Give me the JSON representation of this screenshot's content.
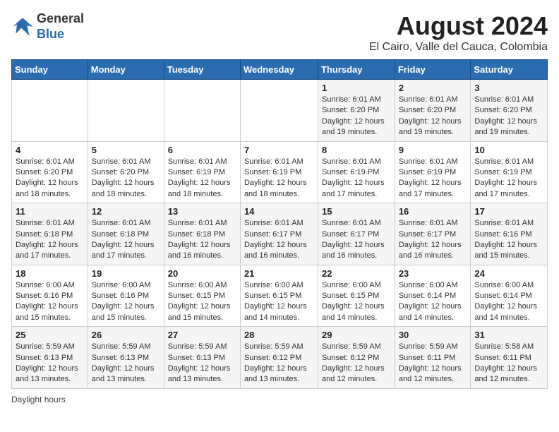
{
  "header": {
    "logo_general": "General",
    "logo_blue": "Blue",
    "title": "August 2024",
    "subtitle": "El Cairo, Valle del Cauca, Colombia"
  },
  "days_of_week": [
    "Sunday",
    "Monday",
    "Tuesday",
    "Wednesday",
    "Thursday",
    "Friday",
    "Saturday"
  ],
  "weeks": [
    [
      {
        "day": "",
        "info": ""
      },
      {
        "day": "",
        "info": ""
      },
      {
        "day": "",
        "info": ""
      },
      {
        "day": "",
        "info": ""
      },
      {
        "day": "1",
        "info": "Sunrise: 6:01 AM\nSunset: 6:20 PM\nDaylight: 12 hours\nand 19 minutes."
      },
      {
        "day": "2",
        "info": "Sunrise: 6:01 AM\nSunset: 6:20 PM\nDaylight: 12 hours\nand 19 minutes."
      },
      {
        "day": "3",
        "info": "Sunrise: 6:01 AM\nSunset: 6:20 PM\nDaylight: 12 hours\nand 19 minutes."
      }
    ],
    [
      {
        "day": "4",
        "info": "Sunrise: 6:01 AM\nSunset: 6:20 PM\nDaylight: 12 hours\nand 18 minutes."
      },
      {
        "day": "5",
        "info": "Sunrise: 6:01 AM\nSunset: 6:20 PM\nDaylight: 12 hours\nand 18 minutes."
      },
      {
        "day": "6",
        "info": "Sunrise: 6:01 AM\nSunset: 6:19 PM\nDaylight: 12 hours\nand 18 minutes."
      },
      {
        "day": "7",
        "info": "Sunrise: 6:01 AM\nSunset: 6:19 PM\nDaylight: 12 hours\nand 18 minutes."
      },
      {
        "day": "8",
        "info": "Sunrise: 6:01 AM\nSunset: 6:19 PM\nDaylight: 12 hours\nand 17 minutes."
      },
      {
        "day": "9",
        "info": "Sunrise: 6:01 AM\nSunset: 6:19 PM\nDaylight: 12 hours\nand 17 minutes."
      },
      {
        "day": "10",
        "info": "Sunrise: 6:01 AM\nSunset: 6:19 PM\nDaylight: 12 hours\nand 17 minutes."
      }
    ],
    [
      {
        "day": "11",
        "info": "Sunrise: 6:01 AM\nSunset: 6:18 PM\nDaylight: 12 hours\nand 17 minutes."
      },
      {
        "day": "12",
        "info": "Sunrise: 6:01 AM\nSunset: 6:18 PM\nDaylight: 12 hours\nand 17 minutes."
      },
      {
        "day": "13",
        "info": "Sunrise: 6:01 AM\nSunset: 6:18 PM\nDaylight: 12 hours\nand 16 minutes."
      },
      {
        "day": "14",
        "info": "Sunrise: 6:01 AM\nSunset: 6:17 PM\nDaylight: 12 hours\nand 16 minutes."
      },
      {
        "day": "15",
        "info": "Sunrise: 6:01 AM\nSunset: 6:17 PM\nDaylight: 12 hours\nand 16 minutes."
      },
      {
        "day": "16",
        "info": "Sunrise: 6:01 AM\nSunset: 6:17 PM\nDaylight: 12 hours\nand 16 minutes."
      },
      {
        "day": "17",
        "info": "Sunrise: 6:01 AM\nSunset: 6:16 PM\nDaylight: 12 hours\nand 15 minutes."
      }
    ],
    [
      {
        "day": "18",
        "info": "Sunrise: 6:00 AM\nSunset: 6:16 PM\nDaylight: 12 hours\nand 15 minutes."
      },
      {
        "day": "19",
        "info": "Sunrise: 6:00 AM\nSunset: 6:16 PM\nDaylight: 12 hours\nand 15 minutes."
      },
      {
        "day": "20",
        "info": "Sunrise: 6:00 AM\nSunset: 6:15 PM\nDaylight: 12 hours\nand 15 minutes."
      },
      {
        "day": "21",
        "info": "Sunrise: 6:00 AM\nSunset: 6:15 PM\nDaylight: 12 hours\nand 14 minutes."
      },
      {
        "day": "22",
        "info": "Sunrise: 6:00 AM\nSunset: 6:15 PM\nDaylight: 12 hours\nand 14 minutes."
      },
      {
        "day": "23",
        "info": "Sunrise: 6:00 AM\nSunset: 6:14 PM\nDaylight: 12 hours\nand 14 minutes."
      },
      {
        "day": "24",
        "info": "Sunrise: 6:00 AM\nSunset: 6:14 PM\nDaylight: 12 hours\nand 14 minutes."
      }
    ],
    [
      {
        "day": "25",
        "info": "Sunrise: 5:59 AM\nSunset: 6:13 PM\nDaylight: 12 hours\nand 13 minutes."
      },
      {
        "day": "26",
        "info": "Sunrise: 5:59 AM\nSunset: 6:13 PM\nDaylight: 12 hours\nand 13 minutes."
      },
      {
        "day": "27",
        "info": "Sunrise: 5:59 AM\nSunset: 6:13 PM\nDaylight: 12 hours\nand 13 minutes."
      },
      {
        "day": "28",
        "info": "Sunrise: 5:59 AM\nSunset: 6:12 PM\nDaylight: 12 hours\nand 13 minutes."
      },
      {
        "day": "29",
        "info": "Sunrise: 5:59 AM\nSunset: 6:12 PM\nDaylight: 12 hours\nand 12 minutes."
      },
      {
        "day": "30",
        "info": "Sunrise: 5:59 AM\nSunset: 6:11 PM\nDaylight: 12 hours\nand 12 minutes."
      },
      {
        "day": "31",
        "info": "Sunrise: 5:58 AM\nSunset: 6:11 PM\nDaylight: 12 hours\nand 12 minutes."
      }
    ]
  ],
  "footer": {
    "label": "Daylight hours"
  }
}
